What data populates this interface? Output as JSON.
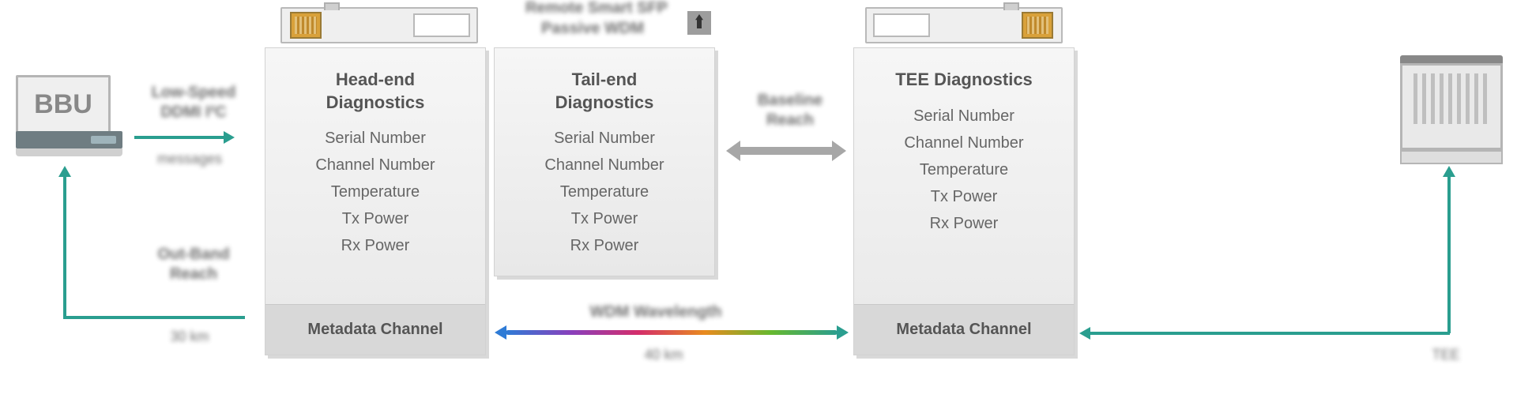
{
  "bbu": {
    "label": "BBU"
  },
  "arrows": {
    "top_left_label": "Low-Speed\nDDMI I²C",
    "top_left_sub": "messages",
    "bottom_left_label": "Out-Band\nReach",
    "bottom_left_sub": "30 km",
    "right_grey_label": "Baseline\nReach",
    "wdm_label": "WDM Wavelength",
    "wdm_sub": "40 km",
    "right_sub": "TEE"
  },
  "top_center": {
    "line1": "Remote Smart SFP",
    "line2": "Passive WDM"
  },
  "panels": {
    "head": {
      "title_l1": "Head-end",
      "title_l2": "Diagnostics",
      "items": [
        "Serial Number",
        "Channel Number",
        "Temperature",
        "Tx Power",
        "Rx Power"
      ],
      "footer": "Metadata Channel"
    },
    "tail": {
      "title_l1": "Tail-end",
      "title_l2": "Diagnostics",
      "items": [
        "Serial Number",
        "Channel Number",
        "Temperature",
        "Tx Power",
        "Rx Power"
      ]
    },
    "tee": {
      "title_l1": "TEE Diagnostics",
      "items": [
        "Serial Number",
        "Channel Number",
        "Temperature",
        "Tx Power",
        "Rx Power"
      ],
      "footer": "Metadata Channel"
    }
  }
}
